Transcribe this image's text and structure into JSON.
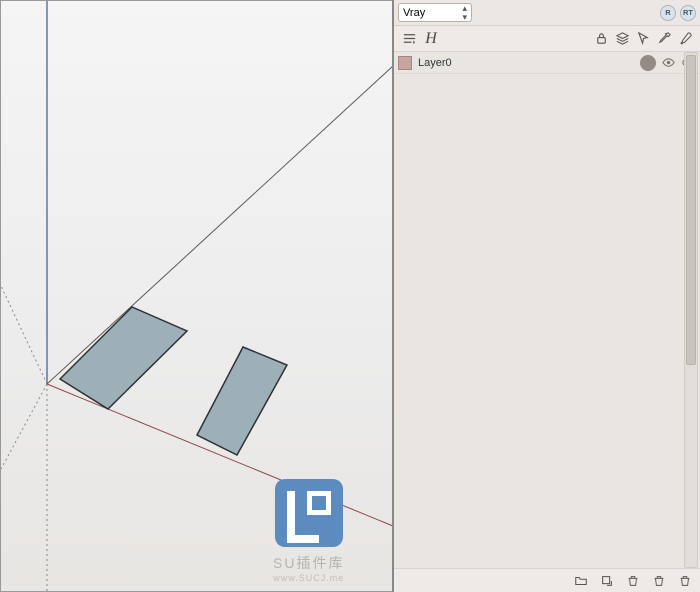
{
  "header": {
    "dropdown_value": "Vray",
    "render_button_label": "R",
    "rt_button_label": "RT"
  },
  "toolbar": {
    "list_icon": "options-icon",
    "letter_label": "H",
    "icons": {
      "lock": "lock-icon",
      "layers": "layers-icon",
      "cursor": "cursor-icon",
      "eyedropper": "eyedropper-icon",
      "brush": "brush-icon"
    }
  },
  "layers": [
    {
      "name": "Layer0",
      "swatch_color": "#c6a6a0",
      "indicators": {
        "dot": true,
        "eye": true,
        "cloud": true
      }
    }
  ],
  "footer": {
    "icons": [
      "folder-icon",
      "new-icon",
      "trash1-icon",
      "trash2-icon",
      "trash3-icon"
    ]
  },
  "watermark": {
    "title": "SU插件库",
    "url": "www.SUCJ.me"
  }
}
